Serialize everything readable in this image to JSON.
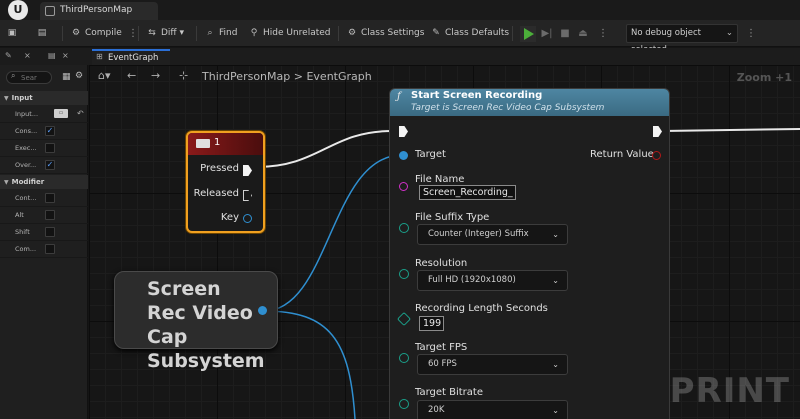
{
  "window": {
    "logo": "U",
    "tab_label": "ThirdPersonMap"
  },
  "toolbar": {
    "compile_label": "Compile",
    "diff_label": "Diff",
    "find_label": "Find",
    "hide_unrelated_label": "Hide Unrelated",
    "class_settings_label": "Class Settings",
    "class_defaults_label": "Class Defaults",
    "debug_object_label": "No debug object selected",
    "play_color": "#4caf3a"
  },
  "left_panel": {
    "search_placeholder": "Sear",
    "sections": [
      {
        "label": "Input",
        "rows": [
          {
            "label": "Input...",
            "control": "key"
          },
          {
            "label": "Cons...",
            "control": "checkbox",
            "checked": true
          },
          {
            "label": "Exec...",
            "control": "checkbox",
            "checked": false
          },
          {
            "label": "Over...",
            "control": "checkbox",
            "checked": true
          }
        ]
      },
      {
        "label": "Modifier",
        "rows": [
          {
            "label": "Cont...",
            "control": "checkbox",
            "checked": false
          },
          {
            "label": "Alt",
            "control": "checkbox",
            "checked": false
          },
          {
            "label": "Shift",
            "control": "checkbox",
            "checked": false
          },
          {
            "label": "Com...",
            "control": "checkbox",
            "checked": false
          }
        ]
      }
    ]
  },
  "graph": {
    "tab_label": "EventGraph",
    "breadcrumb_root": "ThirdPersonMap",
    "breadcrumb_separator": ">",
    "breadcrumb_leaf": "EventGraph",
    "zoom_label": "Zoom +1",
    "watermark": "LEVEL BLUEPRINT"
  },
  "key_node": {
    "title": "1",
    "pressed_label": "Pressed",
    "released_label": "Released",
    "key_label": "Key",
    "border_color": "#f0a020"
  },
  "subsystem_node": {
    "title": "Screen Rec Video Cap Subsystem"
  },
  "function_node": {
    "title": "Start Screen Recording",
    "subtitle": "Target is Screen Rec Video Cap Subsystem",
    "target_label": "Target",
    "return_label": "Return Value",
    "file_name_label": "File Name",
    "file_name_value": "Screen_Recording_",
    "file_suffix_label": "File Suffix Type",
    "file_suffix_value": "Counter (Integer) Suffix",
    "resolution_label": "Resolution",
    "resolution_value": "Full HD (1920x1080)",
    "recording_length_label": "Recording Length Seconds",
    "recording_length_value": "199",
    "target_fps_label": "Target FPS",
    "target_fps_value": "60 FPS",
    "target_bitrate_label": "Target Bitrate",
    "target_bitrate_value": "20K",
    "header_color": "#4e86a2"
  }
}
